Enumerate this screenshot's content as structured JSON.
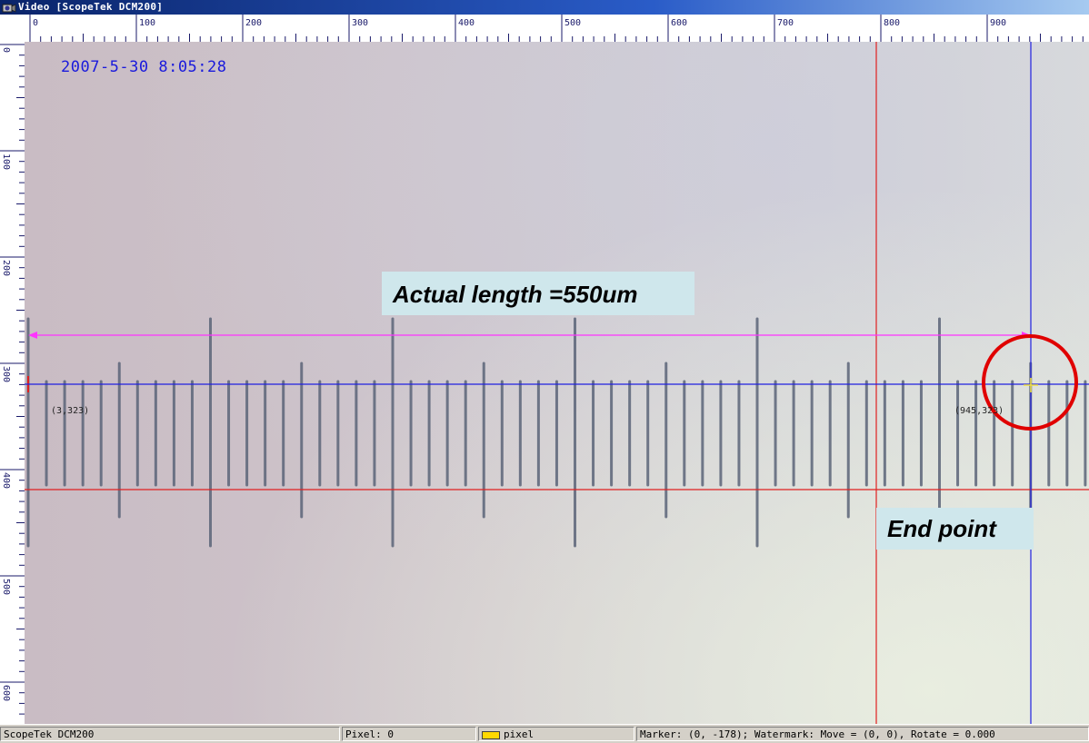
{
  "window": {
    "title": "Video [ScopeTek DCM200]"
  },
  "rulers": {
    "horizontal_labels": [
      "0",
      "100",
      "200",
      "300",
      "400",
      "500",
      "600",
      "700",
      "800",
      "900"
    ],
    "vertical_labels": [
      "0",
      "100",
      "200",
      "300",
      "400",
      "500",
      "600"
    ]
  },
  "overlay": {
    "timestamp": "2007-5-30 8:05:28",
    "start_point_label": "(3,323)",
    "end_point_label": "(945,323)",
    "length_callout": "Actual length =550um",
    "endpoint_callout": "End point",
    "colors": {
      "measure_arrow": "#ff33ff",
      "blue_crosshair": "#2020e0",
      "red_guides": "#e02020",
      "end_circle": "#e00000",
      "callout_bg": "#cfe7ec"
    }
  },
  "statusbar": {
    "app_name": "ScopeTek DCM200",
    "pixel_readout": "Pixel: 0",
    "unit_label": "pixel",
    "marker_readout": "Marker: (0, -178); Watermark: Move = (0, 0), Rotate = 0.000"
  }
}
